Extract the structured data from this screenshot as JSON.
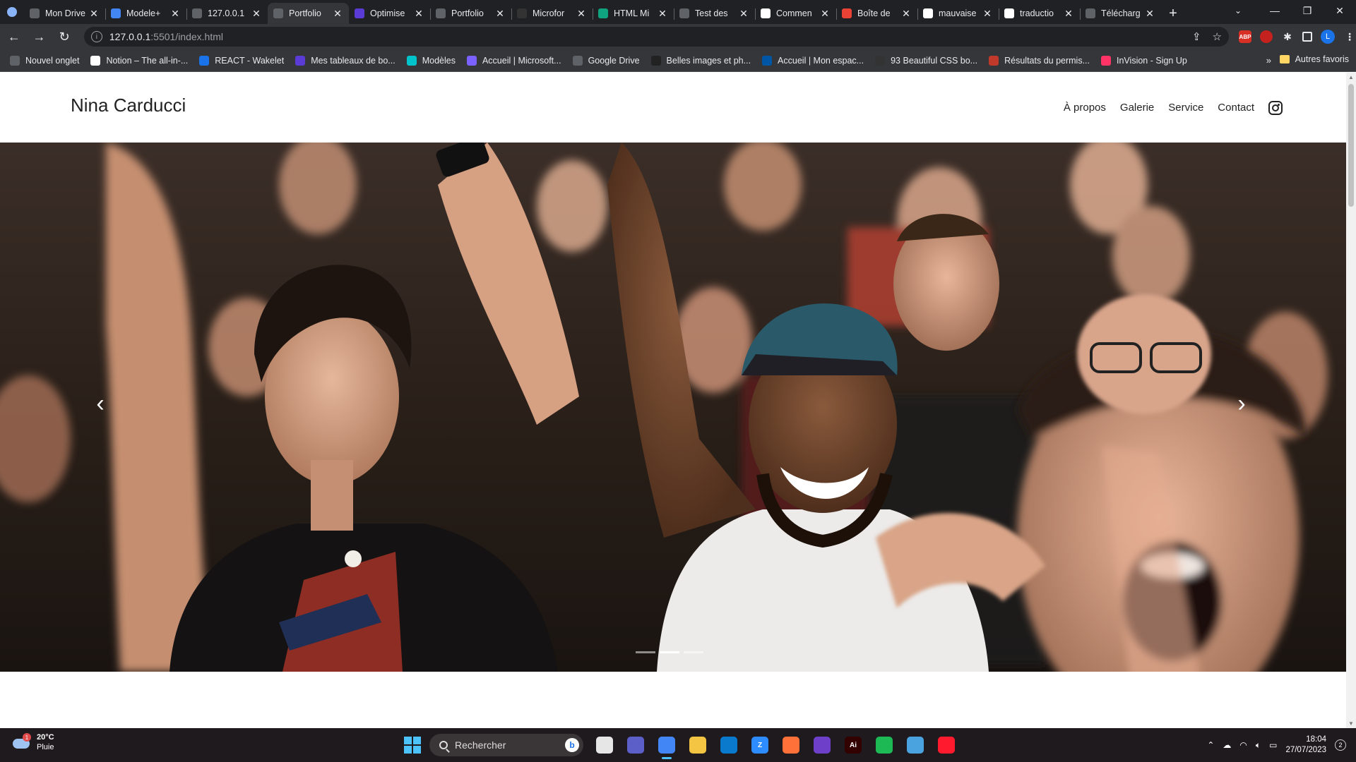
{
  "browser": {
    "tabs": [
      {
        "title": "Mon Drive",
        "icon": "google-drive-icon",
        "color": "#5f6368"
      },
      {
        "title": "Modele+",
        "icon": "google-docs-icon",
        "color": "#4285f4"
      },
      {
        "title": "127.0.0.1",
        "icon": "globe-icon",
        "color": "#5f6368"
      },
      {
        "title": "Portfolio",
        "icon": "globe-icon",
        "color": "#5f6368",
        "active": true
      },
      {
        "title": "Optimise",
        "icon": "d-app-icon",
        "color": "#5b3bd6"
      },
      {
        "title": "Portfolio",
        "icon": "globe-icon",
        "color": "#5f6368"
      },
      {
        "title": "Microfor",
        "icon": "media-icon",
        "color": "#333"
      },
      {
        "title": "HTML Mi",
        "icon": "chatgpt-icon",
        "color": "#10a37f"
      },
      {
        "title": "Test des",
        "icon": "car-icon",
        "color": "#5f6368"
      },
      {
        "title": "Commen",
        "icon": "google-icon",
        "color": "#fff"
      },
      {
        "title": "Boîte de",
        "icon": "gmail-icon",
        "color": "#ea4335"
      },
      {
        "title": "mauvaise",
        "icon": "google-icon",
        "color": "#fff"
      },
      {
        "title": "traductio",
        "icon": "google-icon",
        "color": "#fff"
      },
      {
        "title": "Télécharg",
        "icon": "download-icon",
        "color": "#5f6368"
      }
    ],
    "new_tab": "+",
    "address": {
      "host": "127.0.0.1",
      "path": ":5501/index.html"
    },
    "bookmarks": [
      {
        "label": "Nouvel onglet",
        "icon": "globe-icon",
        "color": "#5f6368"
      },
      {
        "label": "Notion – The all-in-...",
        "icon": "notion-icon",
        "color": "#fff"
      },
      {
        "label": "REACT - Wakelet",
        "icon": "wakelet-icon",
        "color": "#1a73e8"
      },
      {
        "label": "Mes tableaux de bo...",
        "icon": "d-app-icon",
        "color": "#5b3bd6"
      },
      {
        "label": "Modèles",
        "icon": "canva-icon",
        "color": "#00c4cc"
      },
      {
        "label": "Accueil | Microsoft...",
        "icon": "microsoft-icon",
        "color": "#7b61ff"
      },
      {
        "label": "Google Drive",
        "icon": "globe-icon",
        "color": "#5f6368"
      },
      {
        "label": "Belles images et ph...",
        "icon": "camera-icon",
        "color": "#222"
      },
      {
        "label": "Accueil | Mon espac...",
        "icon": "flag-icon",
        "color": "#0055a4"
      },
      {
        "label": "93 Beautiful CSS bo...",
        "icon": "css-icon",
        "color": "#333"
      },
      {
        "label": "Résultats du permis...",
        "icon": "person-icon",
        "color": "#c0392b"
      },
      {
        "label": "InVision - Sign Up",
        "icon": "invision-icon",
        "color": "#ff3366"
      }
    ],
    "bookmarks_more": "»",
    "bookmarks_folder": "Autres favoris"
  },
  "site": {
    "title": "Nina Carducci",
    "nav": [
      "À propos",
      "Galerie",
      "Service",
      "Contact"
    ],
    "carousel": {
      "prev": "‹",
      "next": "›",
      "slides": 3,
      "active_slide": 1
    }
  },
  "taskbar": {
    "weather": {
      "temp": "20°C",
      "condition": "Pluie",
      "badge": "1"
    },
    "search_placeholder": "Rechercher",
    "apps": [
      {
        "name": "task-view-icon",
        "color": "#e6e6e6",
        "label": ""
      },
      {
        "name": "teams-icon",
        "color": "#5b5fc7",
        "label": ""
      },
      {
        "name": "chrome-icon",
        "color": "#4285f4",
        "label": "",
        "active": true
      },
      {
        "name": "file-explorer-icon",
        "color": "#f4c542",
        "label": ""
      },
      {
        "name": "vscode-icon",
        "color": "#0a7acc",
        "label": ""
      },
      {
        "name": "zoom-icon",
        "color": "#2d8cff",
        "label": "Z"
      },
      {
        "name": "firefox-icon",
        "color": "#ff7139",
        "label": ""
      },
      {
        "name": "github-desktop-icon",
        "color": "#6e40c9",
        "label": ""
      },
      {
        "name": "illustrator-icon",
        "color": "#330000",
        "label": "Ai"
      },
      {
        "name": "spotify-icon",
        "color": "#1db954",
        "label": ""
      },
      {
        "name": "browser-globe-icon",
        "color": "#4aa3df",
        "label": ""
      },
      {
        "name": "opera-icon",
        "color": "#ff1b2d",
        "label": ""
      }
    ],
    "time": "18:04",
    "date": "27/07/2023",
    "notifications": "2"
  }
}
